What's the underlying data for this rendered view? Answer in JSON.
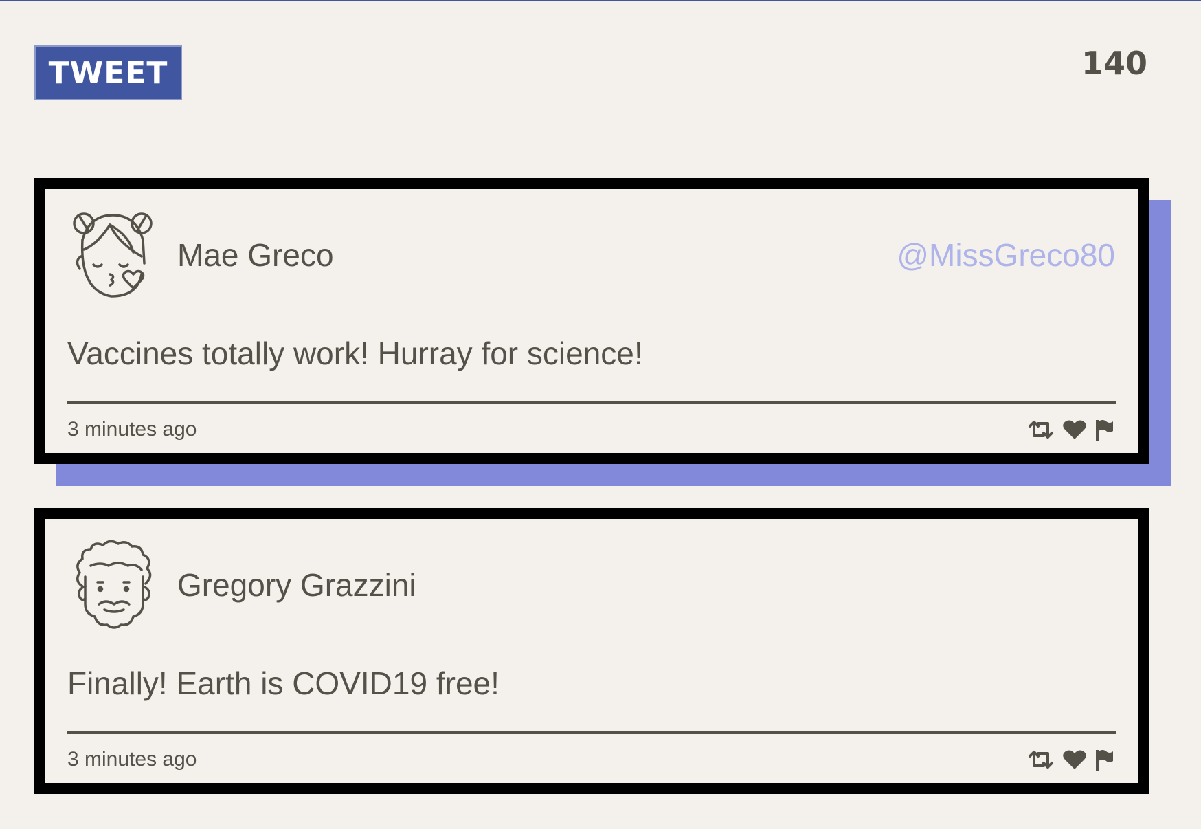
{
  "composer": {
    "tweet_button_label": "TWEET",
    "char_counter": "140"
  },
  "colors": {
    "accent": "#4056a1",
    "background": "#f4f1ed",
    "text": "#545149",
    "shadow": "#8289db",
    "handle": "#aeb4ea",
    "border": "#000000"
  },
  "tweets": [
    {
      "avatar_icon": "kissing-girl-avatar-icon",
      "author_name": "Mae Greco",
      "handle": "@MissGreco80",
      "text": "Vaccines totally work! Hurray for science!",
      "timestamp": "3 minutes ago",
      "actions": [
        "retweet-icon",
        "heart-icon",
        "flag-icon"
      ]
    },
    {
      "avatar_icon": "curly-hair-man-avatar-icon",
      "author_name": "Gregory Grazzini",
      "handle": "",
      "text": "Finally! Earth is COVID19 free!",
      "timestamp": "3 minutes ago",
      "actions": [
        "retweet-icon",
        "heart-icon",
        "flag-icon"
      ]
    }
  ]
}
